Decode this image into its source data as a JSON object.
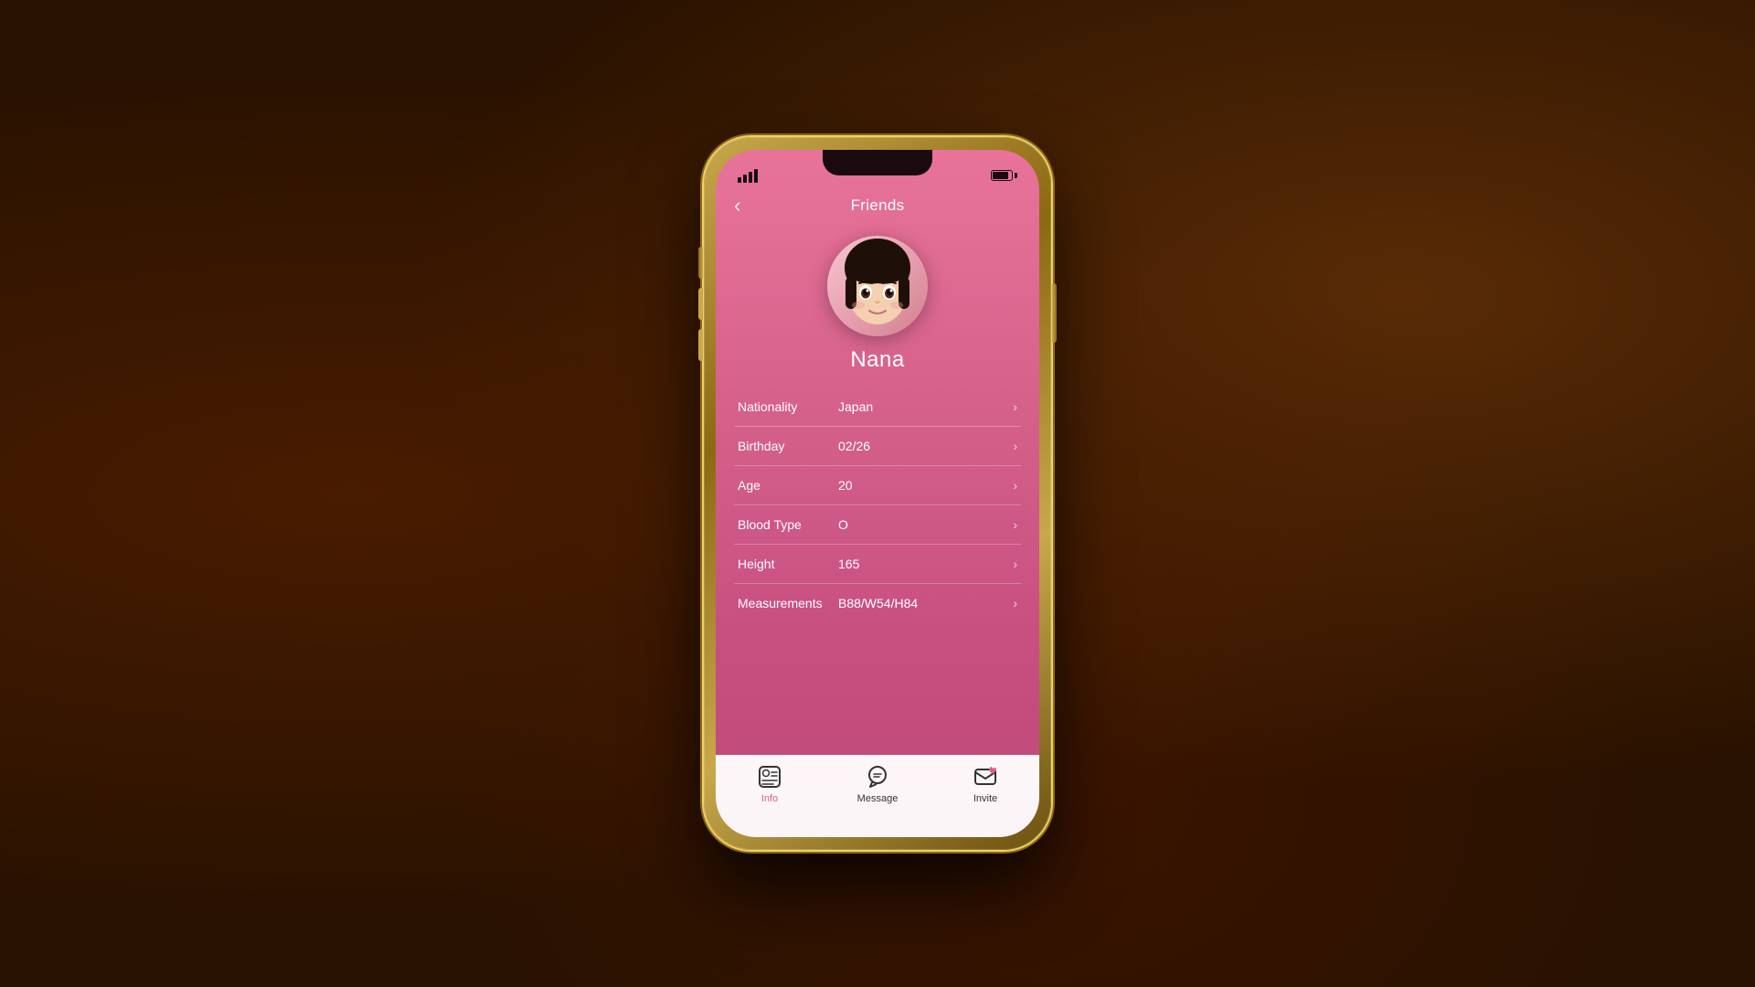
{
  "background": {
    "color": "#2a1200"
  },
  "phone": {
    "status_bar": {
      "signal_label": "Signal",
      "battery_label": "Battery"
    },
    "header": {
      "back_label": "‹",
      "title": "Friends"
    },
    "profile": {
      "name": "Nana",
      "avatar_alt": "Nana avatar"
    },
    "info_rows": [
      {
        "label": "Nationality",
        "value": "Japan"
      },
      {
        "label": "Birthday",
        "value": "02/26"
      },
      {
        "label": "Age",
        "value": "20"
      },
      {
        "label": "Blood Type",
        "value": "O"
      },
      {
        "label": "Height",
        "value": "165"
      },
      {
        "label": "Measurements",
        "value": "B88/W54/H84"
      }
    ],
    "tab_bar": {
      "tabs": [
        {
          "id": "info",
          "label": "Info",
          "active": true
        },
        {
          "id": "message",
          "label": "Message",
          "active": false
        },
        {
          "id": "invite",
          "label": "Invite",
          "active": false
        }
      ]
    }
  }
}
